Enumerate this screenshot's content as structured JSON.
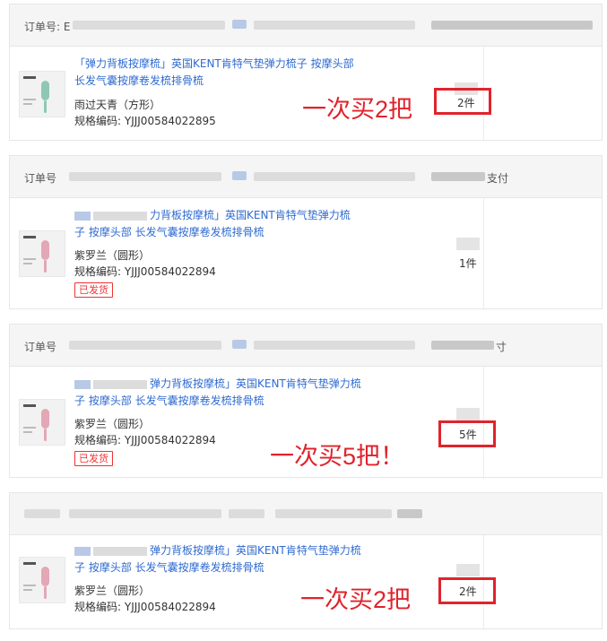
{
  "colors": {
    "accent_red": "#e0232c",
    "link_blue": "#2f6bd0",
    "header_bg": "#f5f5f5"
  },
  "orders": [
    {
      "header_label": "订单号: E",
      "header_tail": "",
      "title_line1": "「弹力背板按摩梳」英国KENT肯特气垫弹力梳子 按摩头部",
      "title_line2": "长发气囊按摩卷发梳排骨梳",
      "variant": "雨过天青（方形）",
      "sku_code": "规格编码: YJJJ00584022895",
      "status": "",
      "quantity": "2件",
      "annotation": "一次买2把",
      "thumb_icon": "comb-product-thumbnail-icon",
      "comb_color": "#8fc7b7"
    },
    {
      "header_label": "订单号",
      "header_tail": "支付",
      "title_line1": "力背板按摩梳」英国KENT肯特气垫弹力梳",
      "title_line2": "子 按摩头部 长发气囊按摩卷发梳排骨梳",
      "variant": "紫罗兰（圆形）",
      "sku_code": "规格编码: YJJJ00584022894",
      "status": "已发货",
      "quantity": "1件",
      "annotation": "",
      "thumb_icon": "comb-product-thumbnail-icon",
      "comb_color": "#e3a7b5"
    },
    {
      "header_label": "订单号",
      "header_tail": "寸",
      "title_line1": "弹力背板按摩梳」英国KENT肯特气垫弹力梳",
      "title_line2": "子 按摩头部 长发气囊按摩卷发梳排骨梳",
      "variant": "紫罗兰（圆形）",
      "sku_code": "规格编码: YJJJ00584022894",
      "status": "已发货",
      "quantity": "5件",
      "annotation": "一次买5把！",
      "thumb_icon": "comb-product-thumbnail-icon",
      "comb_color": "#e3a7b5"
    },
    {
      "header_label": "",
      "header_tail": "",
      "title_line1": "弹力背板按摩梳」英国KENT肯特气垫弹力梳",
      "title_line2": "子 按摩头部 长发气囊按摩卷发梳排骨梳",
      "variant": "紫罗兰（圆形）",
      "sku_code": "规格编码: YJJJ00584022894",
      "status": "",
      "quantity": "2件",
      "annotation": "一次买2把",
      "thumb_icon": "comb-product-thumbnail-icon",
      "comb_color": "#e3a7b5"
    }
  ]
}
